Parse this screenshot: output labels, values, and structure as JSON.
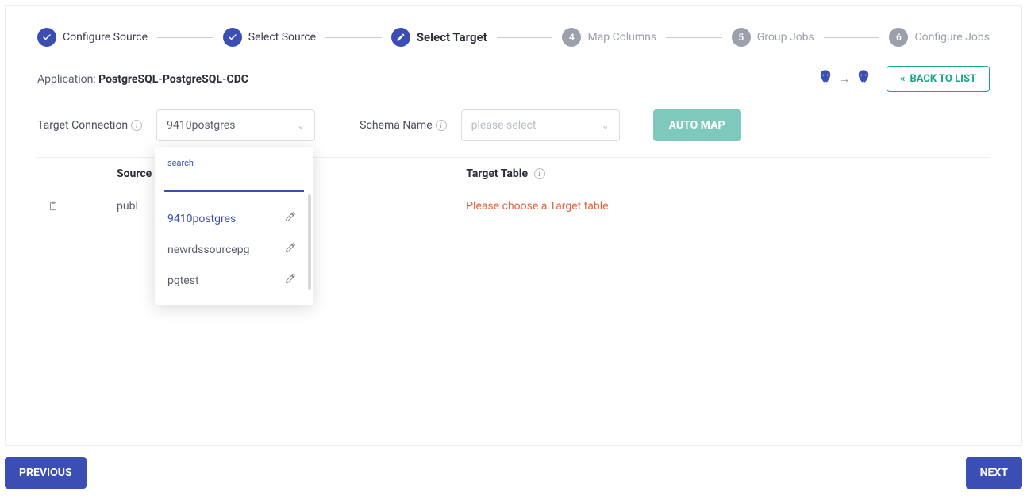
{
  "stepper": {
    "steps": [
      {
        "label": "Configure Source",
        "state": "done"
      },
      {
        "label": "Select Source",
        "state": "done"
      },
      {
        "label": "Select Target",
        "state": "current"
      },
      {
        "num": "4",
        "label": "Map Columns",
        "state": "future"
      },
      {
        "num": "5",
        "label": "Group Jobs",
        "state": "future"
      },
      {
        "num": "6",
        "label": "Configure Jobs",
        "state": "future"
      }
    ]
  },
  "app": {
    "label": "Application: ",
    "name": "PostgreSQL-PostgreSQL-CDC"
  },
  "back_btn": "BACK TO LIST",
  "form": {
    "target_conn_label": "Target Connection",
    "target_conn_value": "9410postgres",
    "schema_label": "Schema Name",
    "schema_placeholder": "please select",
    "automap": "AUTO MAP"
  },
  "dropdown": {
    "search_placeholder": "search",
    "items": [
      {
        "label": "9410postgres",
        "selected": true
      },
      {
        "label": "newrdssourcepg",
        "selected": false
      },
      {
        "label": "pgtest",
        "selected": false
      }
    ]
  },
  "table": {
    "col_source": "Source",
    "col_target": "Target Table",
    "rows": [
      {
        "source": "publ",
        "target_error": "Please choose a Target table."
      }
    ]
  },
  "footer": {
    "prev": "PREVIOUS",
    "next": "NEXT"
  }
}
